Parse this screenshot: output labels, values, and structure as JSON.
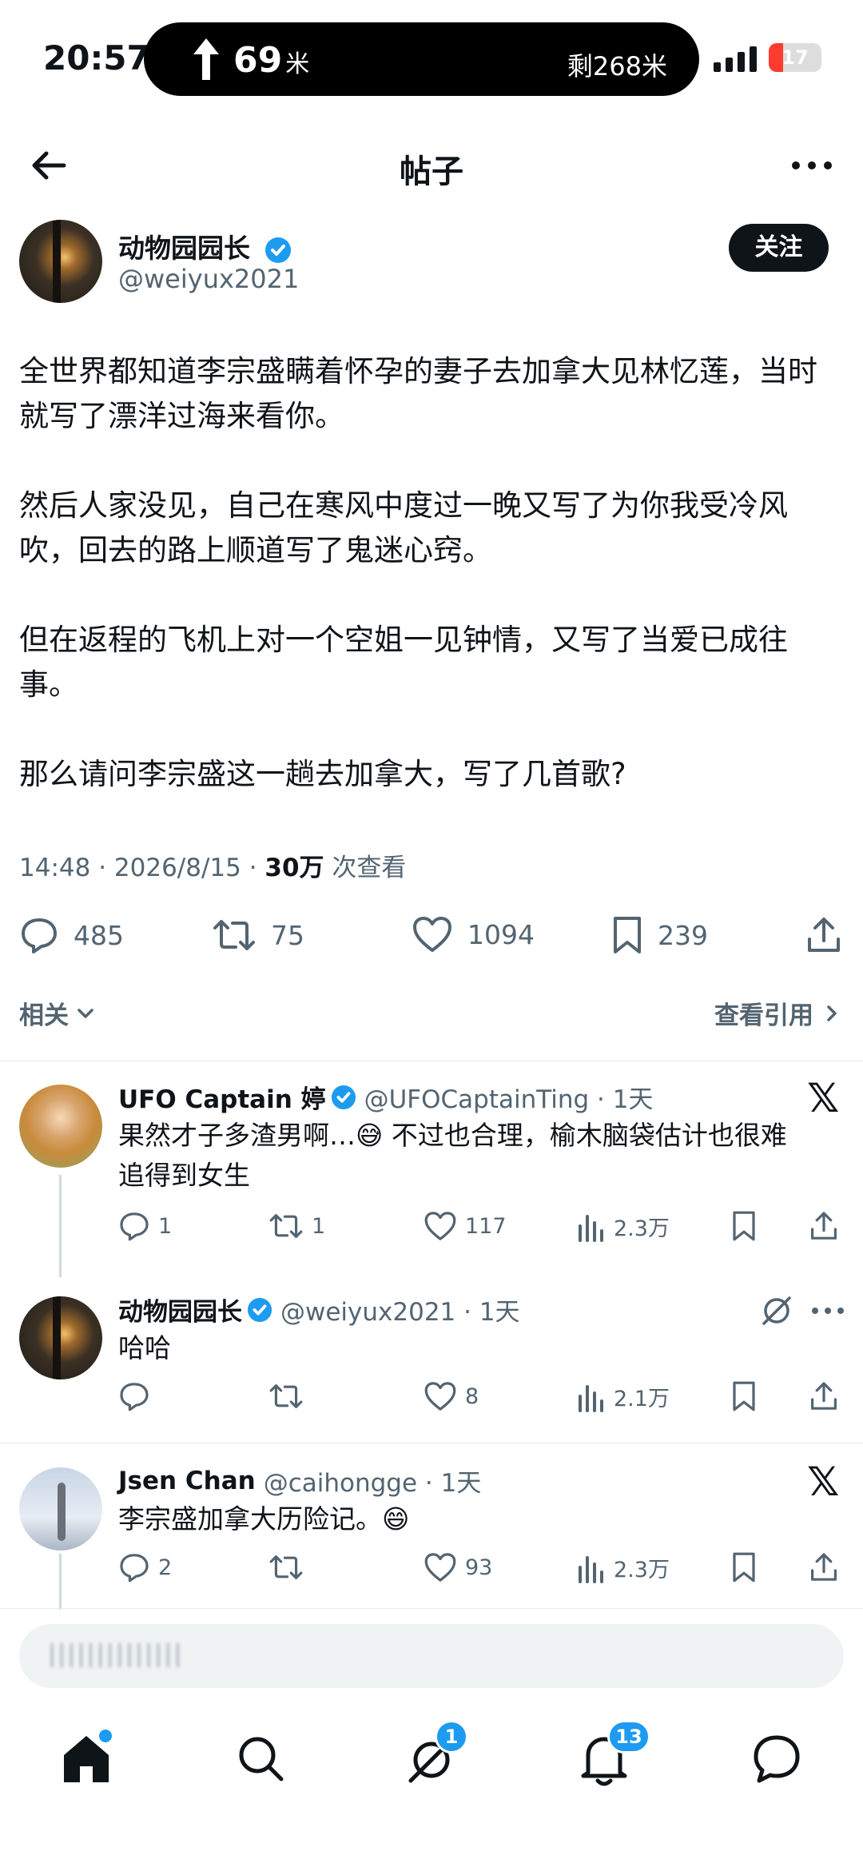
{
  "status_bar": {
    "time": "20:57",
    "nav_distance": "69",
    "nav_unit": "米",
    "nav_remaining": "剩268米",
    "battery": "17",
    "battery_color": "#ff3b30"
  },
  "header": {
    "title": "帖子",
    "back_icon": "back-arrow-icon",
    "more_icon": "more-icon"
  },
  "post": {
    "author_name": "动物园园长",
    "handle": "@weiyux2021",
    "follow_label": "关注",
    "paragraphs": [
      "全世界都知道李宗盛瞒着怀孕的妻子去加拿大见林忆莲，当时就写了漂洋过海来看你。",
      "然后人家没见，自己在寒风中度过一晚又写了为你我受冷风吹，回去的路上顺道写了鬼迷心窍。",
      "但在返程的飞机上对一个空姐一见钟情，又写了当爱已成往事。",
      "那么请问李宗盛这一趟去加拿大，写了几首歌?"
    ],
    "timestamp": "14:48 · 2026/8/15 · ",
    "views_count": "30万",
    "views_label": " 次查看",
    "replies": "485",
    "reposts": "75",
    "likes": "1094",
    "bookmarks": "239"
  },
  "filters": {
    "related_label": "相关",
    "quotes_label": "查看引用"
  },
  "replies": [
    {
      "name": "UFO Captain 婷",
      "handle": "@UFOCaptainTing · 1天",
      "text_line1": "果然才子多渣男啊…😅 不过也合理，榆木脑袋估计也很难",
      "text_line2": "追得到女生",
      "replies": "1",
      "reposts": "1",
      "likes": "117",
      "views": "2.3万",
      "badge_icon": "x-logo-icon"
    },
    {
      "name": "动物园园长",
      "handle": "@weiyux2021 · 1天",
      "text_line1": "哈哈",
      "replies": "",
      "reposts": "",
      "likes": "8",
      "views": "2.1万",
      "badge_icon": "grok-icon"
    },
    {
      "name": "Jsen Chan",
      "handle": "@caihongge · 1天",
      "text_line1": "李宗盛加拿大历险记。😄",
      "replies": "2",
      "reposts": "",
      "likes": "93",
      "views": "2.3万",
      "badge_icon": "x-logo-icon"
    }
  ],
  "compose": {
    "placeholder": "||||||||||||||"
  },
  "tabbar": {
    "grok_badge": "1",
    "notifications_badge": "13",
    "accent": "#1d9bf0"
  }
}
